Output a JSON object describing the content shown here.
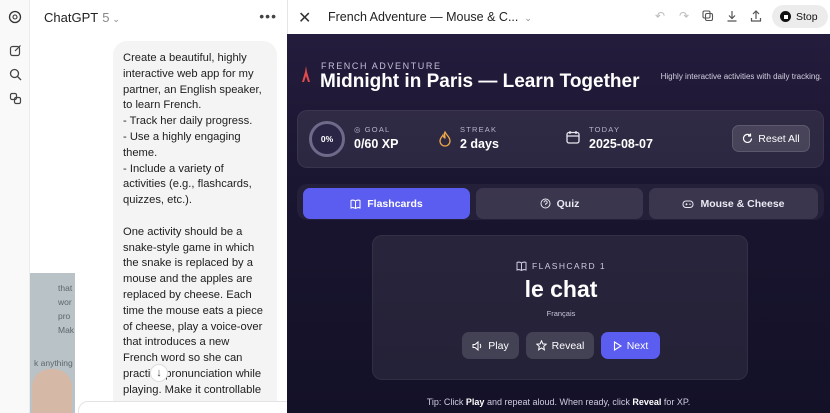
{
  "chat": {
    "model_name": "ChatGPT",
    "model_version": "5",
    "more_label": "•••",
    "message": "Create a beautiful, highly interactive web app for my partner, an English speaker, to learn French.\n- Track her daily progress.\n- Use a highly engaging theme.\n- Include a variety of activities (e.g., flashcards, quizzes, etc.).\n\nOne activity should be a snake-style game in which the snake is replaced by a mouse and the apples are replaced by cheese. Each time the mouse eats a piece of cheese, play a voice-over that introduces a new French word so she can practice pronunciation while playing. Make it controllable with the arrow keys.",
    "overlay_lines": [
      "that",
      "wor",
      "pro",
      "Mak",
      "k anything"
    ]
  },
  "canvas": {
    "title": "French Adventure — Mouse & C...",
    "stop_label": "Stop",
    "icons": [
      "undo-icon",
      "redo-icon",
      "copy-icon",
      "download-icon",
      "share-icon"
    ]
  },
  "app": {
    "eyebrow": "FRENCH ADVENTURE",
    "title": "Midnight in Paris — Learn Together",
    "subtitle": "Highly interactive activities with daily tracking.",
    "progress_percent": "0%",
    "goal_label": "GOAL",
    "goal_value": "0/60 XP",
    "streak_label": "STREAK",
    "streak_value": "2 days",
    "today_label": "TODAY",
    "today_value": "2025-08-07",
    "reset_label": "Reset All",
    "tabs": [
      {
        "label": "Flashcards",
        "active": true
      },
      {
        "label": "Quiz",
        "active": false
      },
      {
        "label": "Mouse & Cheese",
        "active": false
      }
    ],
    "card": {
      "eyebrow": "FLASHCARD 1",
      "word": "le chat",
      "language": "Français",
      "play_label": "Play",
      "reveal_label": "Reveal",
      "next_label": "Next"
    },
    "tip": {
      "prefix": "Tip: Click ",
      "play": "Play",
      "middle": " and repeat aloud. When ready, click ",
      "reveal": "Reveal",
      "suffix": " for XP."
    },
    "colors": {
      "accent": "#5b5cf0",
      "background": "#1a1530"
    }
  }
}
